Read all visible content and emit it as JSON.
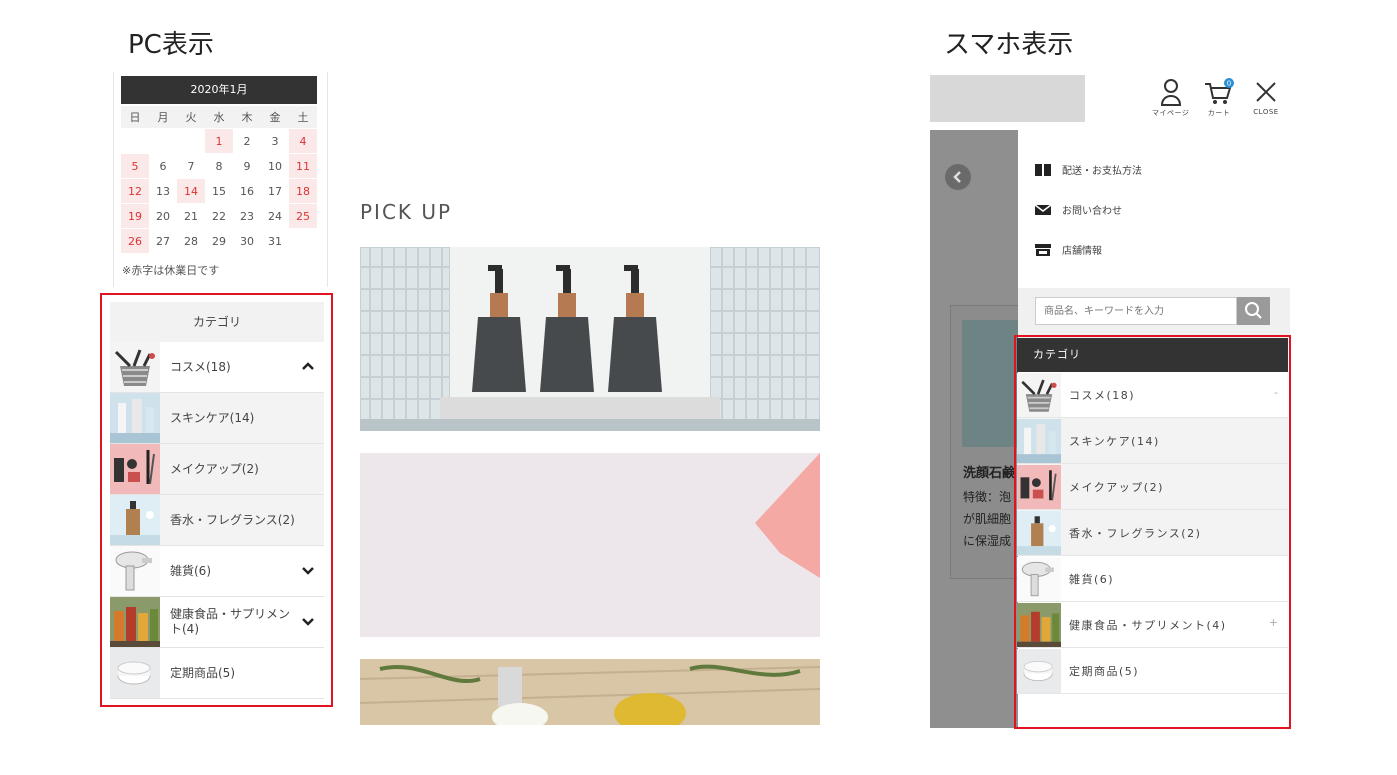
{
  "headings": {
    "pc": "PC表示",
    "sp": "スマホ表示"
  },
  "calendar": {
    "title": "2020年1月",
    "weekdays": [
      "日",
      "月",
      "火",
      "水",
      "木",
      "金",
      "土"
    ],
    "weeks": [
      [
        "",
        "",
        "",
        "1",
        "2",
        "3",
        "4"
      ],
      [
        "5",
        "6",
        "7",
        "8",
        "9",
        "10",
        "11"
      ],
      [
        "12",
        "13",
        "14",
        "15",
        "16",
        "17",
        "18"
      ],
      [
        "19",
        "20",
        "21",
        "22",
        "23",
        "24",
        "25"
      ],
      [
        "26",
        "27",
        "28",
        "29",
        "30",
        "31",
        ""
      ]
    ],
    "holidays": [
      "1",
      "4",
      "5",
      "11",
      "12",
      "14",
      "18",
      "19",
      "25",
      "26"
    ],
    "note": "※赤字は休業日です"
  },
  "pc_category": {
    "title": "カテゴリ",
    "items": [
      {
        "label": "コスメ(18)",
        "sub": false,
        "chevron": "up",
        "thumb": "basket"
      },
      {
        "label": "スキンケア(14)",
        "sub": true,
        "chevron": "",
        "thumb": "skincare"
      },
      {
        "label": "メイクアップ(2)",
        "sub": true,
        "chevron": "",
        "thumb": "makeup"
      },
      {
        "label": "香水・フレグランス(2)",
        "sub": true,
        "chevron": "",
        "thumb": "perfume"
      },
      {
        "label": "雑貨(6)",
        "sub": false,
        "chevron": "down",
        "thumb": "dryer"
      },
      {
        "label": "健康食品・サプリメント(4)",
        "sub": false,
        "chevron": "down",
        "thumb": "bottles"
      },
      {
        "label": "定期商品(5)",
        "sub": false,
        "chevron": "",
        "thumb": "cream"
      }
    ]
  },
  "pickup": {
    "title": "PICK UP"
  },
  "sp_header": {
    "mypage": "マイページ",
    "cart": "カート",
    "cart_count": "0",
    "close": "CLOSE"
  },
  "sp_menu": {
    "links": [
      {
        "label": "配送・お支払方法",
        "icon": "book-icon"
      },
      {
        "label": "お問い合わせ",
        "icon": "mail-icon"
      },
      {
        "label": "店舗情報",
        "icon": "store-icon"
      }
    ],
    "search_placeholder": "商品名、キーワードを入力"
  },
  "sp_background": {
    "product_title": "洗顔石鹸",
    "lines": [
      "特徴：泡",
      "が肌細胞",
      "に保湿成"
    ]
  },
  "sp_category": {
    "title": "カテゴリ",
    "items": [
      {
        "label": "コスメ(18)",
        "sub": false,
        "symbol": "-",
        "thumb": "basket"
      },
      {
        "label": "スキンケア(14)",
        "sub": true,
        "symbol": "",
        "thumb": "skincare"
      },
      {
        "label": "メイクアップ(2)",
        "sub": true,
        "symbol": "",
        "thumb": "makeup"
      },
      {
        "label": "香水・フレグランス(2)",
        "sub": true,
        "symbol": "",
        "thumb": "perfume"
      },
      {
        "label": "雑貨(6)",
        "sub": false,
        "symbol": "",
        "thumb": "dryer"
      },
      {
        "label": "健康食品・サプリメント(4)",
        "sub": false,
        "symbol": "+",
        "thumb": "bottles"
      },
      {
        "label": "定期商品(5)",
        "sub": false,
        "symbol": "",
        "thumb": "cream"
      }
    ]
  },
  "colors": {
    "highlight_red": "#e0141e",
    "holiday_bg": "#fbe8e8",
    "dark": "#333333"
  }
}
